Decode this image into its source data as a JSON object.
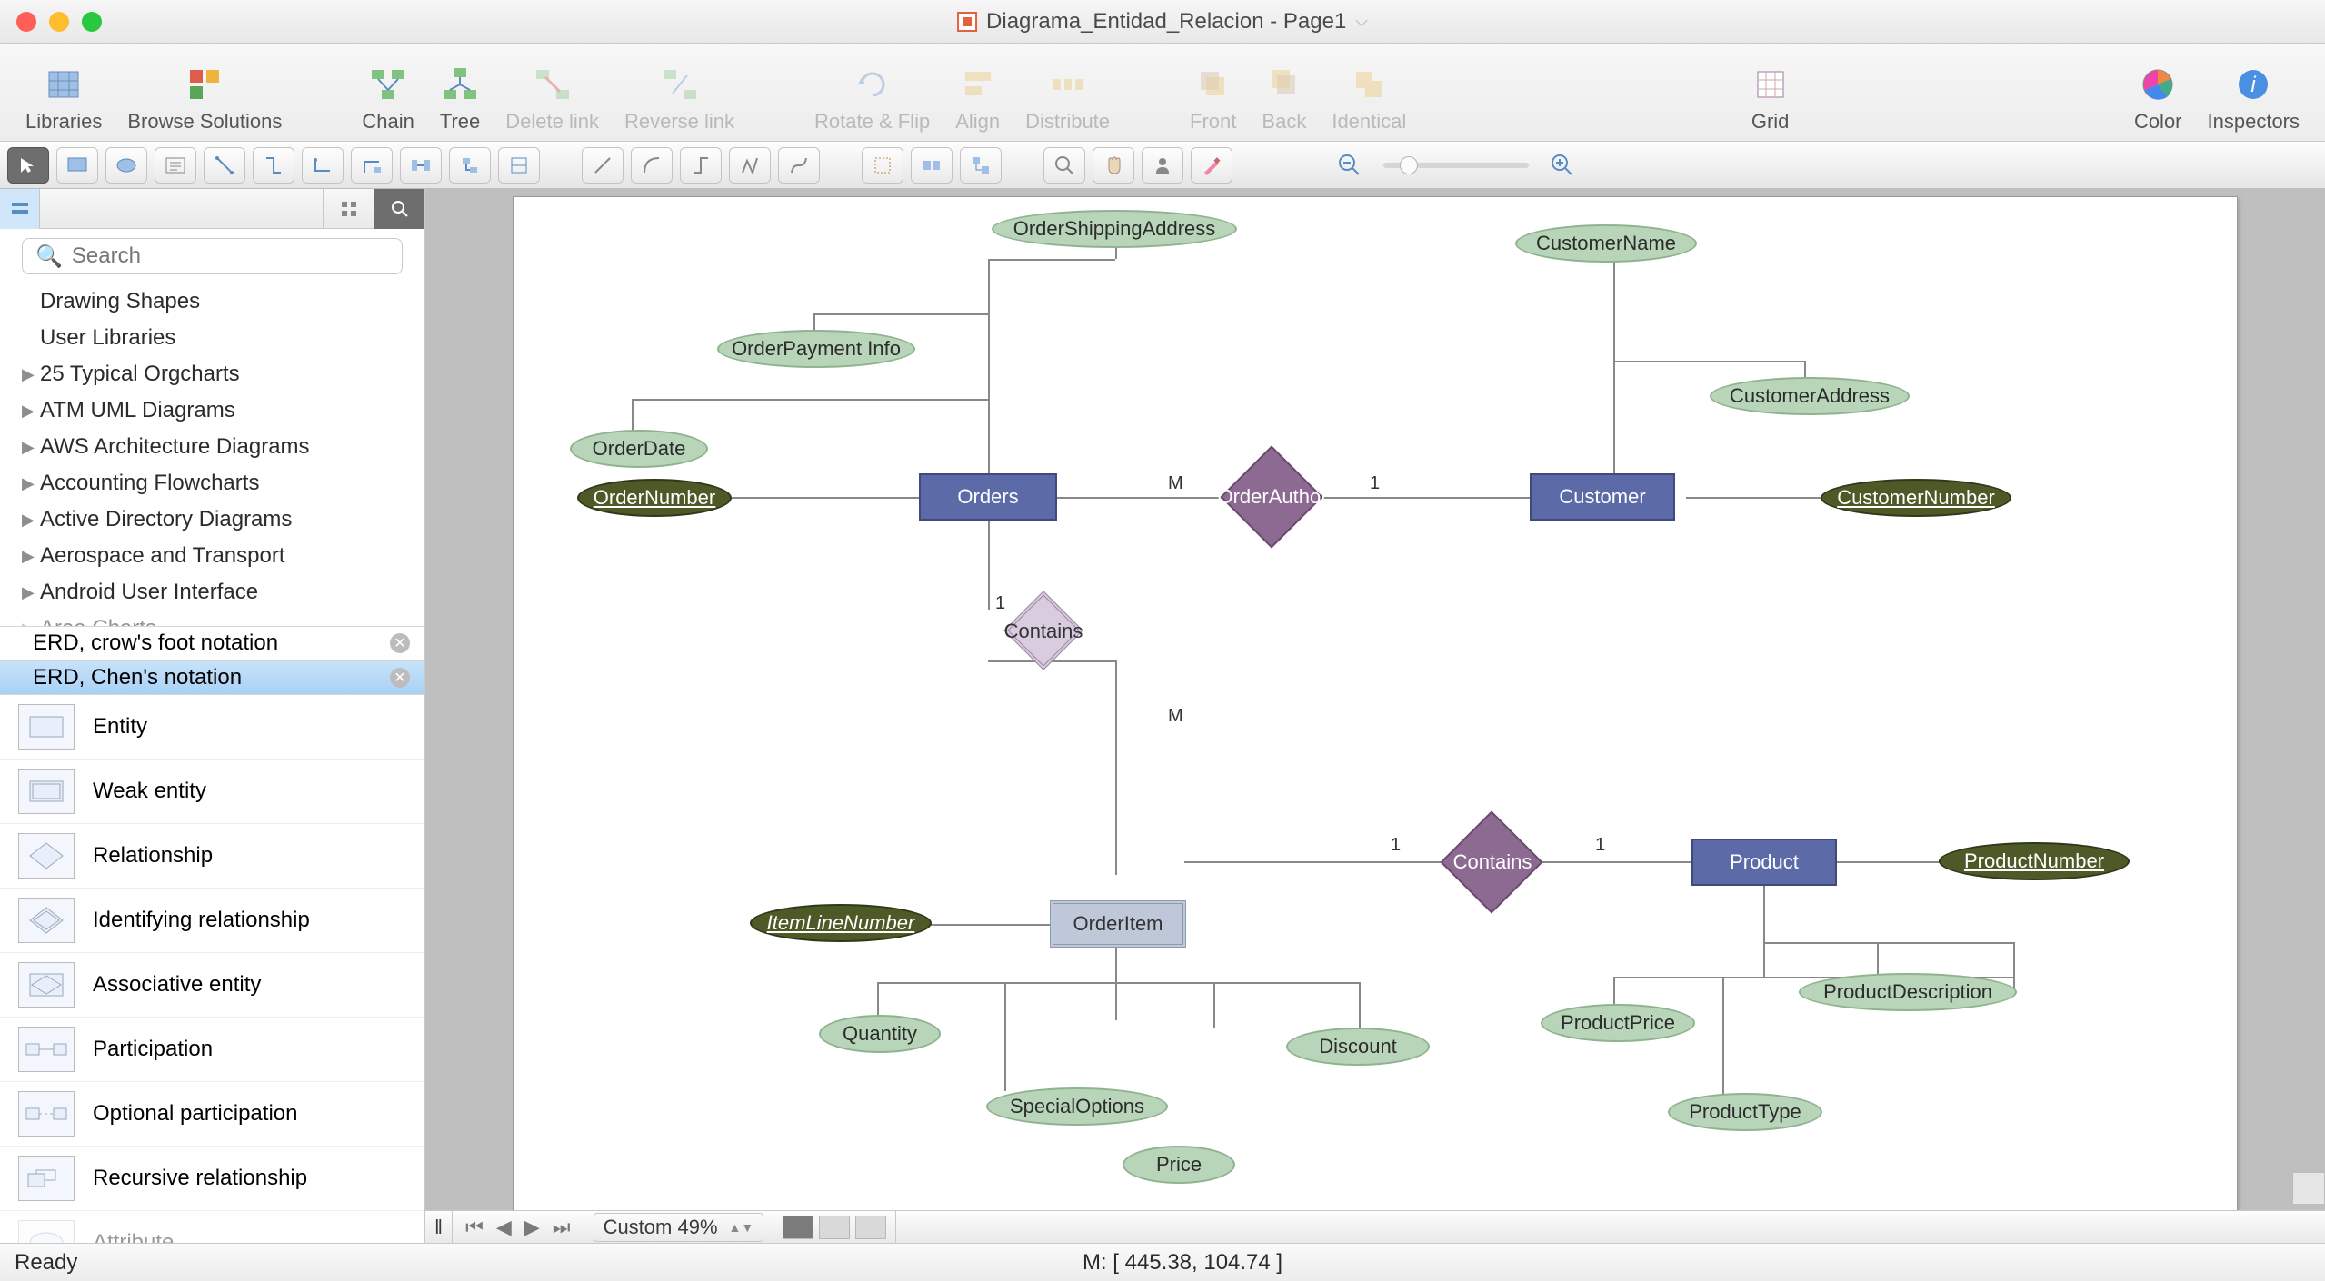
{
  "window": {
    "title": "Diagrama_Entidad_Relacion - Page1"
  },
  "toolbar": {
    "libraries": "Libraries",
    "browse": "Browse Solutions",
    "chain": "Chain",
    "tree": "Tree",
    "delete_link": "Delete link",
    "reverse_link": "Reverse link",
    "rotate_flip": "Rotate & Flip",
    "align": "Align",
    "distribute": "Distribute",
    "front": "Front",
    "back": "Back",
    "identical": "Identical",
    "grid": "Grid",
    "color": "Color",
    "inspectors": "Inspectors"
  },
  "sidebar": {
    "search_placeholder": "Search",
    "categories": [
      "Drawing Shapes",
      "User Libraries",
      "25 Typical Orgcharts",
      "ATM UML Diagrams",
      "AWS Architecture Diagrams",
      "Accounting Flowcharts",
      "Active Directory Diagrams",
      "Aerospace and Transport",
      "Android User Interface",
      "Area Charts"
    ],
    "stencil_tabs": {
      "crowsfoot": "ERD, crow's foot notation",
      "chens": "ERD, Chen's notation"
    },
    "shapes": [
      "Entity",
      "Weak entity",
      "Relationship",
      "Identifying relationship",
      "Associative entity",
      "Participation",
      "Optional participation",
      "Recursive relationship",
      "Attribute"
    ]
  },
  "erd": {
    "entities": {
      "orders": "Orders",
      "customer": "Customer",
      "product": "Product",
      "orderitem": "OrderItem"
    },
    "relationships": {
      "orderauthor": "OrderAuthor",
      "contains1": "Contains",
      "contains2": "Contains"
    },
    "attributes": {
      "orderdate": "OrderDate",
      "orderpayment": "OrderPayment Info",
      "ordershipping": "OrderShippingAddress",
      "ordernumber": "OrderNumber",
      "customername": "CustomerName",
      "customeraddress": "CustomerAddress",
      "customernumber": "CustomerNumber",
      "itemlinenumber": "ItemLineNumber",
      "quantity": "Quantity",
      "specialoptions": "SpecialOptions",
      "price": "Price",
      "discount": "Discount",
      "productnumber": "ProductNumber",
      "productprice": "ProductPrice",
      "productdescription": "ProductDescription",
      "producttype": "ProductType"
    },
    "cardinalities": {
      "m1": "M",
      "one1": "1",
      "one2": "1",
      "m2": "M",
      "one3": "1",
      "one4": "1"
    }
  },
  "footer": {
    "zoom": "Custom 49%",
    "status": "Ready",
    "mouse": "M: [ 445.38, 104.74 ]"
  }
}
